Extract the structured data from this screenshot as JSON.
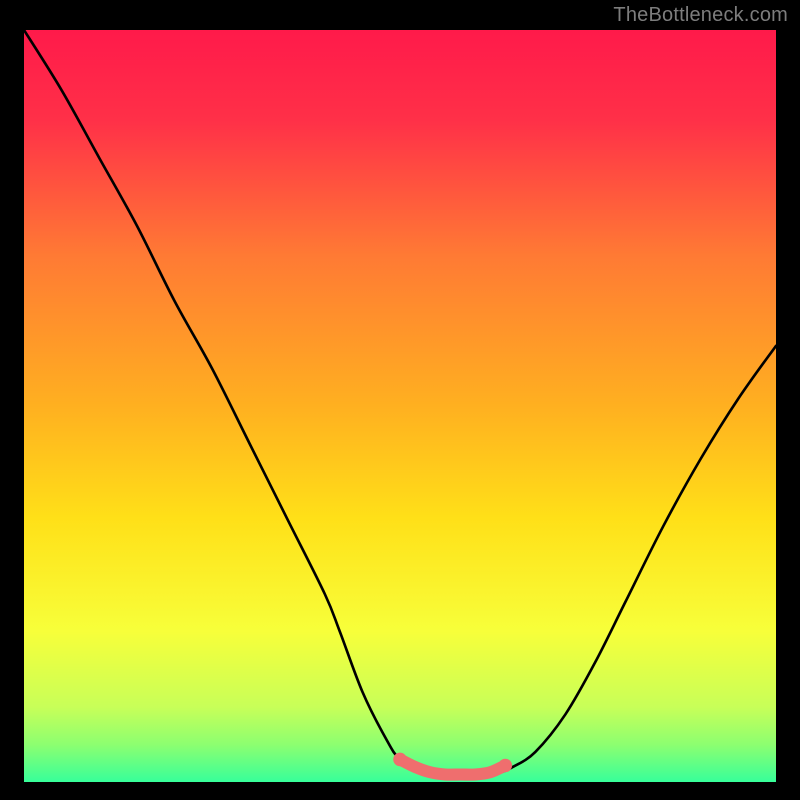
{
  "watermark": "TheBottleneck.com",
  "chart_data": {
    "type": "line",
    "title": "",
    "xlabel": "",
    "ylabel": "",
    "xlim": [
      0,
      100
    ],
    "ylim": [
      0,
      100
    ],
    "grid": false,
    "background_gradient": {
      "stops": [
        {
          "pos": 0.0,
          "color": "#ff1a4a"
        },
        {
          "pos": 0.12,
          "color": "#ff3048"
        },
        {
          "pos": 0.3,
          "color": "#ff7a34"
        },
        {
          "pos": 0.5,
          "color": "#ffb020"
        },
        {
          "pos": 0.65,
          "color": "#ffe018"
        },
        {
          "pos": 0.8,
          "color": "#f7ff3a"
        },
        {
          "pos": 0.9,
          "color": "#c8ff58"
        },
        {
          "pos": 0.95,
          "color": "#8dff70"
        },
        {
          "pos": 1.0,
          "color": "#37ff9a"
        }
      ]
    },
    "series": [
      {
        "name": "bottleneck-curve",
        "x": [
          0,
          5,
          10,
          15,
          20,
          25,
          30,
          35,
          40,
          42,
          45,
          48,
          50,
          53,
          55,
          57,
          60,
          63,
          65,
          68,
          72,
          76,
          80,
          85,
          90,
          95,
          100
        ],
        "y": [
          100,
          92,
          83,
          74,
          64,
          55,
          45,
          35,
          25,
          20,
          12,
          6,
          3,
          1.5,
          1,
          1,
          1,
          1.2,
          2,
          4,
          9,
          16,
          24,
          34,
          43,
          51,
          58
        ]
      }
    ],
    "highlight_segment": {
      "name": "curve-minimum",
      "color": "#ef6e6e",
      "x": [
        50,
        52,
        54,
        56,
        58,
        60,
        62,
        64
      ],
      "y": [
        3,
        2,
        1.3,
        1,
        1,
        1,
        1.3,
        2.2
      ]
    }
  }
}
